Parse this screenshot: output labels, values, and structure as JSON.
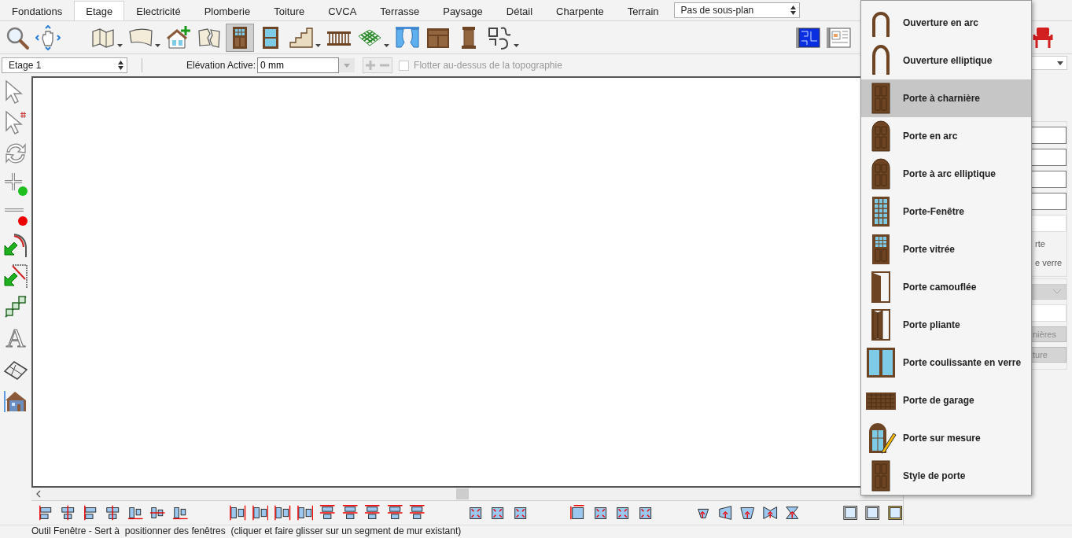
{
  "tabs": [
    {
      "label": "Fondations",
      "selected": false
    },
    {
      "label": "Etage",
      "selected": true
    },
    {
      "label": "Electricité",
      "selected": false
    },
    {
      "label": "Plomberie",
      "selected": false
    },
    {
      "label": "Toiture",
      "selected": false
    },
    {
      "label": "CVCA",
      "selected": false
    },
    {
      "label": "Terrasse",
      "selected": false
    },
    {
      "label": "Paysage",
      "selected": false
    },
    {
      "label": "Détail",
      "selected": false
    },
    {
      "label": "Charpente",
      "selected": false
    },
    {
      "label": "Terrain",
      "selected": false
    }
  ],
  "subplan_select": {
    "value": "Pas de sous-plan"
  },
  "toolbar": {
    "tools": [
      {
        "kind": "zoom",
        "selected": false,
        "dropdown": false
      },
      {
        "kind": "pan",
        "selected": false,
        "dropdown": false
      },
      {
        "kind": "wall",
        "selected": false,
        "dropdown": true
      },
      {
        "kind": "curved_wall",
        "selected": false,
        "dropdown": true
      },
      {
        "kind": "house_plus",
        "selected": false,
        "dropdown": false
      },
      {
        "kind": "broken_wall",
        "selected": false,
        "dropdown": false
      },
      {
        "kind": "door",
        "selected": true,
        "dropdown": false
      },
      {
        "kind": "window",
        "selected": false,
        "dropdown": false
      },
      {
        "kind": "stairs",
        "selected": false,
        "dropdown": true
      },
      {
        "kind": "railing",
        "selected": false,
        "dropdown": false
      },
      {
        "kind": "checker",
        "selected": false,
        "dropdown": true
      },
      {
        "kind": "curtain",
        "selected": false,
        "dropdown": false
      },
      {
        "kind": "cabinet",
        "selected": false,
        "dropdown": false
      },
      {
        "kind": "column",
        "selected": false,
        "dropdown": false
      },
      {
        "kind": "symbols",
        "selected": false,
        "dropdown": true
      }
    ],
    "view_tools": [
      {
        "kind": "plan_blue",
        "selected": false,
        "dropdown": false
      },
      {
        "kind": "layout",
        "selected": false,
        "dropdown": false
      },
      {
        "kind": "chair",
        "selected": false,
        "dropdown": false
      }
    ]
  },
  "floor_select": {
    "value": "Etage 1"
  },
  "elevation": {
    "label": "Elévation Active:",
    "value": "0 mm"
  },
  "float_checkbox": {
    "label": "Flotter au-dessus de la topographie",
    "checked": false
  },
  "text_tool": "A",
  "door_menu": {
    "items": [
      {
        "kind": "arch_opening",
        "label": "Ouverture en arc",
        "selected": false
      },
      {
        "kind": "ellipse_opening",
        "label": "Ouverture elliptique",
        "selected": false
      },
      {
        "kind": "door",
        "label": "Porte à charnière",
        "selected": true
      },
      {
        "kind": "arch_door",
        "label": "Porte en arc",
        "selected": false
      },
      {
        "kind": "arch_door",
        "label": "Porte à arc elliptique",
        "selected": false
      },
      {
        "kind": "french_door",
        "label": "Porte-Fenêtre",
        "selected": false
      },
      {
        "kind": "glass_door",
        "label": "Porte vitrée",
        "selected": false
      },
      {
        "kind": "hidden_door",
        "label": "Porte camouflée",
        "selected": false
      },
      {
        "kind": "folding_door",
        "label": "Porte pliante",
        "selected": false
      },
      {
        "kind": "sliding_door",
        "label": "Porte coulissante en verre",
        "selected": false
      },
      {
        "kind": "garage_door",
        "label": "Porte de garage",
        "selected": false
      },
      {
        "kind": "custom_door",
        "label": "Porte sur mesure",
        "selected": false
      },
      {
        "kind": "door",
        "label": "Style de porte",
        "selected": false
      }
    ]
  },
  "side_panel": {
    "texts": [
      "rte",
      "e verre"
    ],
    "buttons": [
      "nières",
      "ture"
    ]
  },
  "status_bar": "Outil Fenêtre - Sert à  positionner des fenêtres  (cliquer et faire glisser sur un segment de mur existant)"
}
